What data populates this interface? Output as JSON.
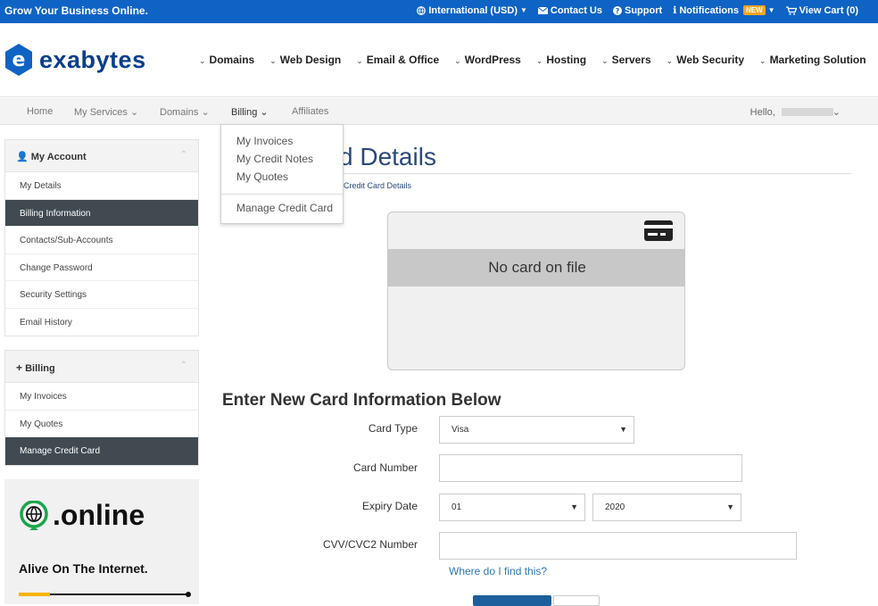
{
  "colors": {
    "topbar": "#0f63c4",
    "brand_blue": "#0a3f8c",
    "active_item": "#404a50",
    "link": "#2a78b8",
    "primary_button": "#1c5f9c"
  },
  "topbar": {
    "tagline": "Grow Your Business Online.",
    "links": [
      {
        "icon": "globe-icon",
        "label": "International (USD)"
      },
      {
        "icon": "envelope-icon",
        "label": "Contact Us"
      },
      {
        "icon": "help-circle-icon",
        "label": "Support"
      },
      {
        "icon": "info-icon",
        "label": "Notifications",
        "badge": "NEW"
      },
      {
        "icon": "cart-icon",
        "label": "View Cart (0)"
      }
    ]
  },
  "header": {
    "logo_text": "exabytes",
    "nav": [
      "Domains",
      "Web Design",
      "Email & Office",
      "WordPress",
      "Hosting",
      "Servers",
      "Web Security",
      "Marketing Solution"
    ]
  },
  "subnav": {
    "items": [
      "Home",
      "My Services",
      "Domains",
      "Billing",
      "Affiliates"
    ],
    "hello": "Hello,"
  },
  "billing_dropdown": {
    "items": [
      "My Invoices",
      "My Credit Notes",
      "My Quotes"
    ],
    "extra": "Manage Credit Card"
  },
  "sidebar": {
    "account": {
      "title": "My Account",
      "items": [
        "My Details",
        "Billing Information",
        "Contacts/Sub-Accounts",
        "Change Password",
        "Security Settings",
        "Email History"
      ]
    },
    "billing": {
      "title": "Billing",
      "items": [
        "My Invoices",
        "My Quotes",
        "Manage Credit Card"
      ]
    },
    "promo": {
      "brand": ".online",
      "tagline": "Alive On The Internet."
    }
  },
  "main": {
    "title": "d Details",
    "breadcrumb": "Credit Card Details",
    "card_status": "No card on file",
    "section_title": "Enter New Card Information Below",
    "form": {
      "card_type_label": "Card Type",
      "card_type_value": "Visa",
      "card_number_label": "Card Number",
      "card_number_value": "",
      "expiry_label": "Expiry Date",
      "expiry_month": "01",
      "expiry_year": "2020",
      "cvv_label": "CVV/CVC2 Number",
      "cvv_value": "",
      "help_link": "Where do I find this?"
    }
  }
}
